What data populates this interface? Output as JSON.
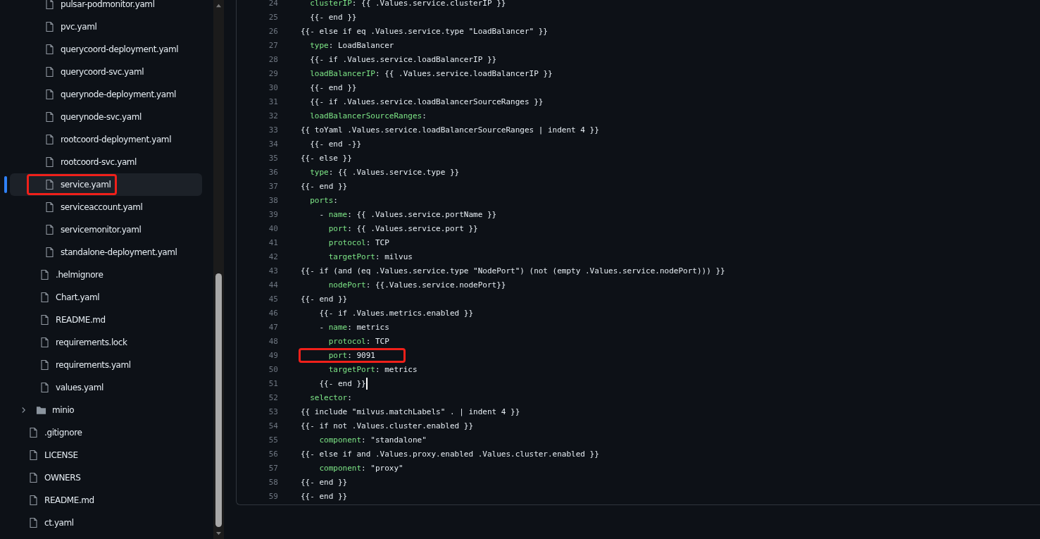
{
  "file_tree": {
    "children": [
      {
        "children": [
          {
            "children": [
              {
                "kind": "file",
                "label": "pulsar-podmonitor.yaml",
                "selected": false,
                "highlighted": false
              },
              {
                "kind": "file",
                "label": "pvc.yaml",
                "selected": false,
                "highlighted": false
              },
              {
                "kind": "file",
                "label": "querycoord-deployment.yaml",
                "selected": false,
                "highlighted": false
              },
              {
                "kind": "file",
                "label": "querycoord-svc.yaml",
                "selected": false,
                "highlighted": false
              },
              {
                "kind": "file",
                "label": "querynode-deployment.yaml",
                "selected": false,
                "highlighted": false
              },
              {
                "kind": "file",
                "label": "querynode-svc.yaml",
                "selected": false,
                "highlighted": false
              },
              {
                "kind": "file",
                "label": "rootcoord-deployment.yaml",
                "selected": false,
                "highlighted": false
              },
              {
                "kind": "file",
                "label": "rootcoord-svc.yaml",
                "selected": false,
                "highlighted": false
              },
              {
                "kind": "file",
                "label": "service.yaml",
                "selected": true,
                "highlighted": true
              },
              {
                "kind": "file",
                "label": "serviceaccount.yaml",
                "selected": false,
                "highlighted": false
              },
              {
                "kind": "file",
                "label": "servicemonitor.yaml",
                "selected": false,
                "highlighted": false
              },
              {
                "kind": "file",
                "label": "standalone-deployment.yaml",
                "selected": false,
                "highlighted": false
              }
            ]
          },
          {
            "kind": "file",
            "label": ".helmignore",
            "selected": false,
            "highlighted": false
          },
          {
            "kind": "file",
            "label": "Chart.yaml",
            "selected": false,
            "highlighted": false
          },
          {
            "kind": "file",
            "label": "README.md",
            "selected": false,
            "highlighted": false
          },
          {
            "kind": "file",
            "label": "requirements.lock",
            "selected": false,
            "highlighted": false
          },
          {
            "kind": "file",
            "label": "requirements.yaml",
            "selected": false,
            "highlighted": false
          },
          {
            "kind": "file",
            "label": "values.yaml",
            "selected": false,
            "highlighted": false
          }
        ]
      },
      {
        "kind": "folder",
        "label": "minio",
        "selected": false,
        "highlighted": false,
        "expanded": false
      },
      {
        "kind": "file",
        "label": ".gitignore",
        "selected": false,
        "highlighted": false
      },
      {
        "kind": "file",
        "label": "LICENSE",
        "selected": false,
        "highlighted": false
      },
      {
        "kind": "file",
        "label": "OWNERS",
        "selected": false,
        "highlighted": false
      },
      {
        "kind": "file",
        "label": "README.md",
        "selected": false,
        "highlighted": false
      },
      {
        "kind": "file",
        "label": "ct.yaml",
        "selected": false,
        "highlighted": false
      }
    ]
  },
  "code_lines": [
    {
      "number": "24",
      "highlighted": false,
      "caret": false,
      "parts": [
        {
          "kind": "key",
          "text": "  clusterIP"
        },
        {
          "kind": "plain",
          "text": ": {{ .Values.service.clusterIP }}"
        }
      ]
    },
    {
      "number": "25",
      "highlighted": false,
      "caret": false,
      "parts": [
        {
          "kind": "plain",
          "text": "  {{- end }}"
        }
      ]
    },
    {
      "number": "26",
      "highlighted": false,
      "caret": false,
      "parts": [
        {
          "kind": "plain",
          "text": "{{- else if eq .Values.service.type \"LoadBalancer\" }}"
        }
      ]
    },
    {
      "number": "27",
      "highlighted": false,
      "caret": false,
      "parts": [
        {
          "kind": "key",
          "text": "  type"
        },
        {
          "kind": "plain",
          "text": ": LoadBalancer"
        }
      ]
    },
    {
      "number": "28",
      "highlighted": false,
      "caret": false,
      "parts": [
        {
          "kind": "plain",
          "text": "  {{- if .Values.service.loadBalancerIP }}"
        }
      ]
    },
    {
      "number": "29",
      "highlighted": false,
      "caret": false,
      "parts": [
        {
          "kind": "key",
          "text": "  loadBalancerIP"
        },
        {
          "kind": "plain",
          "text": ": {{ .Values.service.loadBalancerIP }}"
        }
      ]
    },
    {
      "number": "30",
      "highlighted": false,
      "caret": false,
      "parts": [
        {
          "kind": "plain",
          "text": "  {{- end }}"
        }
      ]
    },
    {
      "number": "31",
      "highlighted": false,
      "caret": false,
      "parts": [
        {
          "kind": "plain",
          "text": "  {{- if .Values.service.loadBalancerSourceRanges }}"
        }
      ]
    },
    {
      "number": "32",
      "highlighted": false,
      "caret": false,
      "parts": [
        {
          "kind": "key",
          "text": "  loadBalancerSourceRanges"
        },
        {
          "kind": "plain",
          "text": ":"
        }
      ]
    },
    {
      "number": "33",
      "highlighted": false,
      "caret": false,
      "parts": [
        {
          "kind": "plain",
          "text": "{{ toYaml .Values.service.loadBalancerSourceRanges | indent 4 }}"
        }
      ]
    },
    {
      "number": "34",
      "highlighted": false,
      "caret": false,
      "parts": [
        {
          "kind": "plain",
          "text": "  {{- end -}}"
        }
      ]
    },
    {
      "number": "35",
      "highlighted": false,
      "caret": false,
      "parts": [
        {
          "kind": "plain",
          "text": "{{- else }}"
        }
      ]
    },
    {
      "number": "36",
      "highlighted": false,
      "caret": false,
      "parts": [
        {
          "kind": "key",
          "text": "  type"
        },
        {
          "kind": "plain",
          "text": ": {{ .Values.service.type }}"
        }
      ]
    },
    {
      "number": "37",
      "highlighted": false,
      "caret": false,
      "parts": [
        {
          "kind": "plain",
          "text": "{{- end }}"
        }
      ]
    },
    {
      "number": "38",
      "highlighted": false,
      "caret": false,
      "parts": [
        {
          "kind": "key",
          "text": "  ports"
        },
        {
          "kind": "plain",
          "text": ":"
        }
      ]
    },
    {
      "number": "39",
      "highlighted": false,
      "caret": false,
      "parts": [
        {
          "kind": "plain",
          "text": "    - "
        },
        {
          "kind": "key",
          "text": "name"
        },
        {
          "kind": "plain",
          "text": ": {{ .Values.service.portName }}"
        }
      ]
    },
    {
      "number": "40",
      "highlighted": false,
      "caret": false,
      "parts": [
        {
          "kind": "key",
          "text": "      port"
        },
        {
          "kind": "plain",
          "text": ": {{ .Values.service.port }}"
        }
      ]
    },
    {
      "number": "41",
      "highlighted": false,
      "caret": false,
      "parts": [
        {
          "kind": "key",
          "text": "      protocol"
        },
        {
          "kind": "plain",
          "text": ": TCP"
        }
      ]
    },
    {
      "number": "42",
      "highlighted": false,
      "caret": false,
      "parts": [
        {
          "kind": "key",
          "text": "      targetPort"
        },
        {
          "kind": "plain",
          "text": ": milvus"
        }
      ]
    },
    {
      "number": "43",
      "highlighted": false,
      "caret": false,
      "parts": [
        {
          "kind": "plain",
          "text": "{{- if (and (eq .Values.service.type \"NodePort\") (not (empty .Values.service.nodePort))) }}"
        }
      ]
    },
    {
      "number": "44",
      "highlighted": false,
      "caret": false,
      "parts": [
        {
          "kind": "key",
          "text": "      nodePort"
        },
        {
          "kind": "plain",
          "text": ": {{.Values.service.nodePort}}"
        }
      ]
    },
    {
      "number": "45",
      "highlighted": false,
      "caret": false,
      "parts": [
        {
          "kind": "plain",
          "text": "{{- end }}"
        }
      ]
    },
    {
      "number": "46",
      "highlighted": false,
      "caret": false,
      "parts": [
        {
          "kind": "plain",
          "text": "    {{- if .Values.metrics.enabled }}"
        }
      ]
    },
    {
      "number": "47",
      "highlighted": false,
      "caret": false,
      "parts": [
        {
          "kind": "plain",
          "text": "    - "
        },
        {
          "kind": "key",
          "text": "name"
        },
        {
          "kind": "plain",
          "text": ": metrics"
        }
      ]
    },
    {
      "number": "48",
      "highlighted": false,
      "caret": false,
      "parts": [
        {
          "kind": "key",
          "text": "      protocol"
        },
        {
          "kind": "plain",
          "text": ": TCP"
        }
      ]
    },
    {
      "number": "49",
      "highlighted": true,
      "caret": false,
      "parts": [
        {
          "kind": "key",
          "text": "      port"
        },
        {
          "kind": "plain",
          "text": ": 9091"
        }
      ]
    },
    {
      "number": "50",
      "highlighted": false,
      "caret": false,
      "parts": [
        {
          "kind": "key",
          "text": "      targetPort"
        },
        {
          "kind": "plain",
          "text": ": metrics"
        }
      ]
    },
    {
      "number": "51",
      "highlighted": false,
      "caret": true,
      "parts": [
        {
          "kind": "plain",
          "text": "    {{- end }}"
        }
      ]
    },
    {
      "number": "52",
      "highlighted": false,
      "caret": false,
      "parts": [
        {
          "kind": "key",
          "text": "  selector"
        },
        {
          "kind": "plain",
          "text": ":"
        }
      ]
    },
    {
      "number": "53",
      "highlighted": false,
      "caret": false,
      "parts": [
        {
          "kind": "plain",
          "text": "{{ include \"milvus.matchLabels\" . | indent 4 }}"
        }
      ]
    },
    {
      "number": "54",
      "highlighted": false,
      "caret": false,
      "parts": [
        {
          "kind": "plain",
          "text": "{{- if not .Values.cluster.enabled }}"
        }
      ]
    },
    {
      "number": "55",
      "highlighted": false,
      "caret": false,
      "parts": [
        {
          "kind": "key",
          "text": "    component"
        },
        {
          "kind": "plain",
          "text": ": \"standalone\""
        }
      ]
    },
    {
      "number": "56",
      "highlighted": false,
      "caret": false,
      "parts": [
        {
          "kind": "plain",
          "text": "{{- else if and .Values.proxy.enabled .Values.cluster.enabled }}"
        }
      ]
    },
    {
      "number": "57",
      "highlighted": false,
      "caret": false,
      "parts": [
        {
          "kind": "key",
          "text": "    component"
        },
        {
          "kind": "plain",
          "text": ": \"proxy\""
        }
      ]
    },
    {
      "number": "58",
      "highlighted": false,
      "caret": false,
      "parts": [
        {
          "kind": "plain",
          "text": "{{- end }}"
        }
      ]
    },
    {
      "number": "59",
      "highlighted": false,
      "caret": false,
      "parts": [
        {
          "kind": "plain",
          "text": "{{- end }}"
        }
      ]
    }
  ]
}
